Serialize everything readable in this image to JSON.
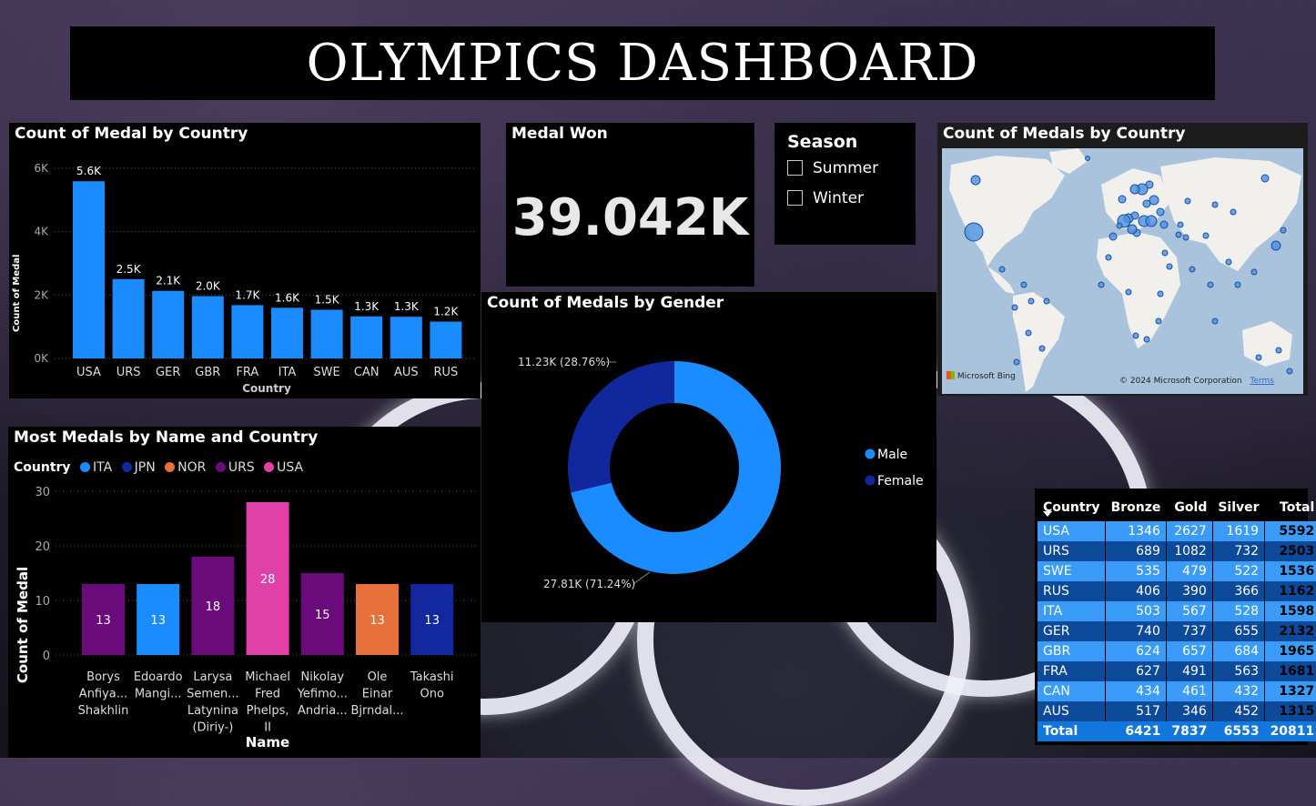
{
  "dashboard_title": "OLYMPICS DASHBOARD",
  "colors": {
    "bar_blue": "#1a8cff",
    "ITA": "#1a8cff",
    "JPN": "#1328a0",
    "NOR": "#e8703a",
    "URS": "#6b0a7a",
    "USA": "#e040a8",
    "male": "#1a8cff",
    "female": "#10289c"
  },
  "medal_by_country": {
    "title": "Count of Medal by Country",
    "y_axis_label": "Count of Medal",
    "x_axis_label": "Country",
    "y_ticks": [
      "0K",
      "2K",
      "4K",
      "6K"
    ]
  },
  "medal_won": {
    "title": "Medal Won",
    "value": "39.042K"
  },
  "season": {
    "title": "Season",
    "options": [
      "Summer",
      "Winter"
    ]
  },
  "map": {
    "title": "Count of Medals by Country",
    "brand": "Microsoft Bing",
    "copyright": "© 2024 Microsoft Corporation",
    "terms": "Terms"
  },
  "gender": {
    "title": "Count of Medals by Gender",
    "female_label": "11.23K (28.76%)",
    "male_label": "27.81K (71.24%)",
    "legend": [
      "Male",
      "Female"
    ]
  },
  "most_medals": {
    "title": "Most Medals by Name and Country",
    "legend_title": "Country",
    "legend_items": [
      "ITA",
      "JPN",
      "NOR",
      "URS",
      "USA"
    ],
    "y_axis_label": "Count of Medal",
    "x_axis_label": "Name",
    "y_ticks": [
      "0",
      "10",
      "20",
      "30"
    ]
  },
  "table": {
    "headers": [
      "Country",
      "Bronze",
      "Gold",
      "Silver",
      "Total"
    ],
    "rows": [
      [
        "USA",
        "1346",
        "2627",
        "1619",
        "5592"
      ],
      [
        "URS",
        "689",
        "1082",
        "732",
        "2503"
      ],
      [
        "SWE",
        "535",
        "479",
        "522",
        "1536"
      ],
      [
        "RUS",
        "406",
        "390",
        "366",
        "1162"
      ],
      [
        "ITA",
        "503",
        "567",
        "528",
        "1598"
      ],
      [
        "GER",
        "740",
        "737",
        "655",
        "2132"
      ],
      [
        "GBR",
        "624",
        "657",
        "684",
        "1965"
      ],
      [
        "FRA",
        "627",
        "491",
        "563",
        "1681"
      ],
      [
        "CAN",
        "434",
        "461",
        "432",
        "1327"
      ],
      [
        "AUS",
        "517",
        "346",
        "452",
        "1315"
      ]
    ],
    "total": [
      "Total",
      "6421",
      "7837",
      "6553",
      "20811"
    ]
  },
  "chart_data": [
    {
      "type": "bar",
      "title": "Count of Medal by Country",
      "xlabel": "Country",
      "ylabel": "Count of Medal",
      "categories": [
        "USA",
        "URS",
        "GER",
        "GBR",
        "FRA",
        "ITA",
        "SWE",
        "CAN",
        "AUS",
        "RUS"
      ],
      "values": [
        5592,
        2503,
        2132,
        1965,
        1681,
        1598,
        1536,
        1327,
        1315,
        1162
      ],
      "data_labels": [
        "5.6K",
        "2.5K",
        "2.1K",
        "2.0K",
        "1.7K",
        "1.6K",
        "1.5K",
        "1.3K",
        "1.3K",
        "1.2K"
      ],
      "ylim": [
        0,
        6000
      ]
    },
    {
      "type": "pie",
      "title": "Count of Medals by Gender",
      "categories": [
        "Male",
        "Female"
      ],
      "values": [
        27810,
        11230
      ],
      "percent": [
        71.24,
        28.76
      ]
    },
    {
      "type": "bar",
      "title": "Most Medals by Name and Country",
      "xlabel": "Name",
      "ylabel": "Count of Medal",
      "categories": [
        [
          "Borys",
          "Anfiya...",
          "Shakhlin"
        ],
        [
          "Edoardo",
          "Mangi..."
        ],
        [
          "Larysa",
          "Semen...",
          "Latynina",
          "(Diriy-)"
        ],
        [
          "Michael",
          "Fred",
          "Phelps,",
          "II"
        ],
        [
          "Nikolay",
          "Yefimo...",
          "Andria..."
        ],
        [
          "Ole",
          "Einar",
          "Bjrndal..."
        ],
        [
          "Takashi",
          "Ono"
        ]
      ],
      "values": [
        13,
        13,
        18,
        28,
        15,
        13,
        13
      ],
      "country": [
        "URS",
        "ITA",
        "URS",
        "USA",
        "URS",
        "NOR",
        "JPN"
      ],
      "ylim": [
        0,
        30
      ]
    }
  ]
}
